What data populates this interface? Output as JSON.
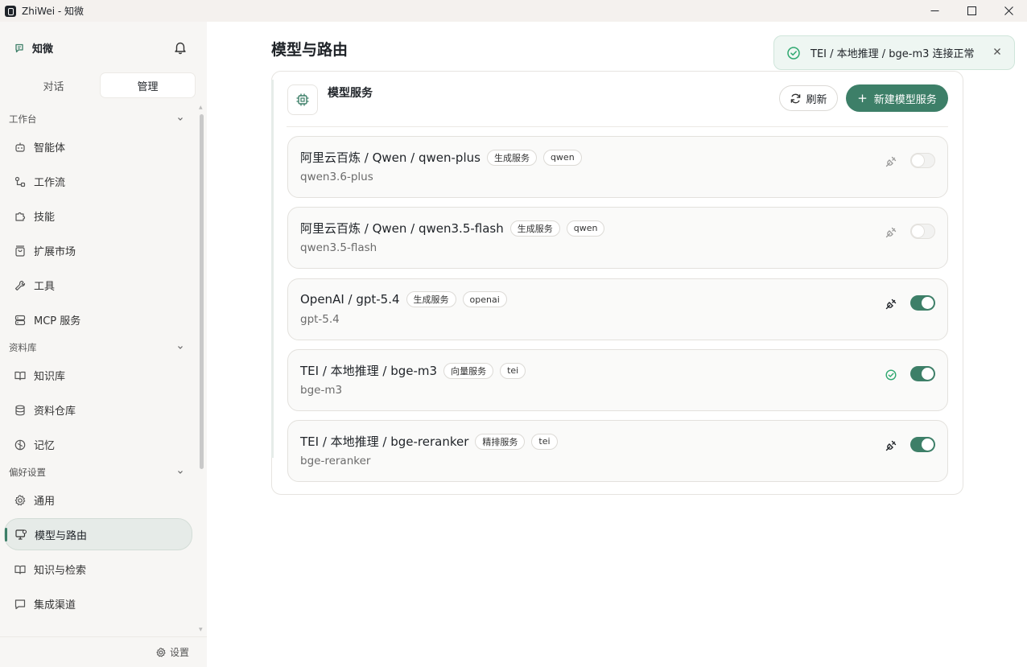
{
  "window": {
    "title": "ZhiWei - 知微"
  },
  "sidebar": {
    "brand": "知微",
    "mode_tabs": [
      "对话",
      "管理"
    ],
    "active_mode": "管理",
    "sections": [
      {
        "title": "工作台",
        "items": [
          {
            "label": "智能体",
            "icon": "bot-icon"
          },
          {
            "label": "工作流",
            "icon": "workflow-icon"
          },
          {
            "label": "技能",
            "icon": "puzzle-icon"
          },
          {
            "label": "扩展市场",
            "icon": "shopping-bag-icon"
          },
          {
            "label": "工具",
            "icon": "wrench-icon"
          },
          {
            "label": "MCP 服务",
            "icon": "server-icon"
          }
        ]
      },
      {
        "title": "资料库",
        "items": [
          {
            "label": "知识库",
            "icon": "book-icon"
          },
          {
            "label": "资料仓库",
            "icon": "database-icon"
          },
          {
            "label": "记忆",
            "icon": "brain-icon"
          }
        ]
      },
      {
        "title": "偏好设置",
        "items": [
          {
            "label": "通用",
            "icon": "gear-icon"
          },
          {
            "label": "模型与路由",
            "icon": "monitor-icon",
            "active": true
          },
          {
            "label": "知识与检索",
            "icon": "book-open-icon"
          },
          {
            "label": "集成渠道",
            "icon": "message-icon"
          }
        ]
      }
    ],
    "footer_settings": "设置"
  },
  "main": {
    "page_title": "模型与路由",
    "card": {
      "title": "模型服务",
      "refresh_label": "刷新",
      "new_label": "新建模型服务",
      "services": [
        {
          "name": "阿里云百炼 / Qwen / qwen-plus",
          "badges": [
            "生成服务",
            "qwen"
          ],
          "model": "qwen3.6-plus",
          "status_icon": "plug-icon",
          "enabled": false
        },
        {
          "name": "阿里云百炼 / Qwen / qwen3.5-flash",
          "badges": [
            "生成服务",
            "qwen"
          ],
          "model": "qwen3.5-flash",
          "status_icon": "plug-icon",
          "enabled": false
        },
        {
          "name": "OpenAI / gpt-5.4",
          "badges": [
            "生成服务",
            "openai"
          ],
          "model": "gpt-5.4",
          "status_icon": "plug-icon",
          "enabled": true
        },
        {
          "name": "TEI / 本地推理 / bge-m3",
          "badges": [
            "向量服务",
            "tei"
          ],
          "model": "bge-m3",
          "status_icon": "check-circle-icon",
          "enabled": true
        },
        {
          "name": "TEI / 本地推理 / bge-reranker",
          "badges": [
            "精排服务",
            "tei"
          ],
          "model": "bge-reranker",
          "status_icon": "plug-icon",
          "enabled": true
        }
      ]
    }
  },
  "toast": {
    "message": "TEI / 本地推理 / bge-m3 连接正常"
  },
  "colors": {
    "accent": "#3d7f68",
    "success": "#2fa870"
  }
}
